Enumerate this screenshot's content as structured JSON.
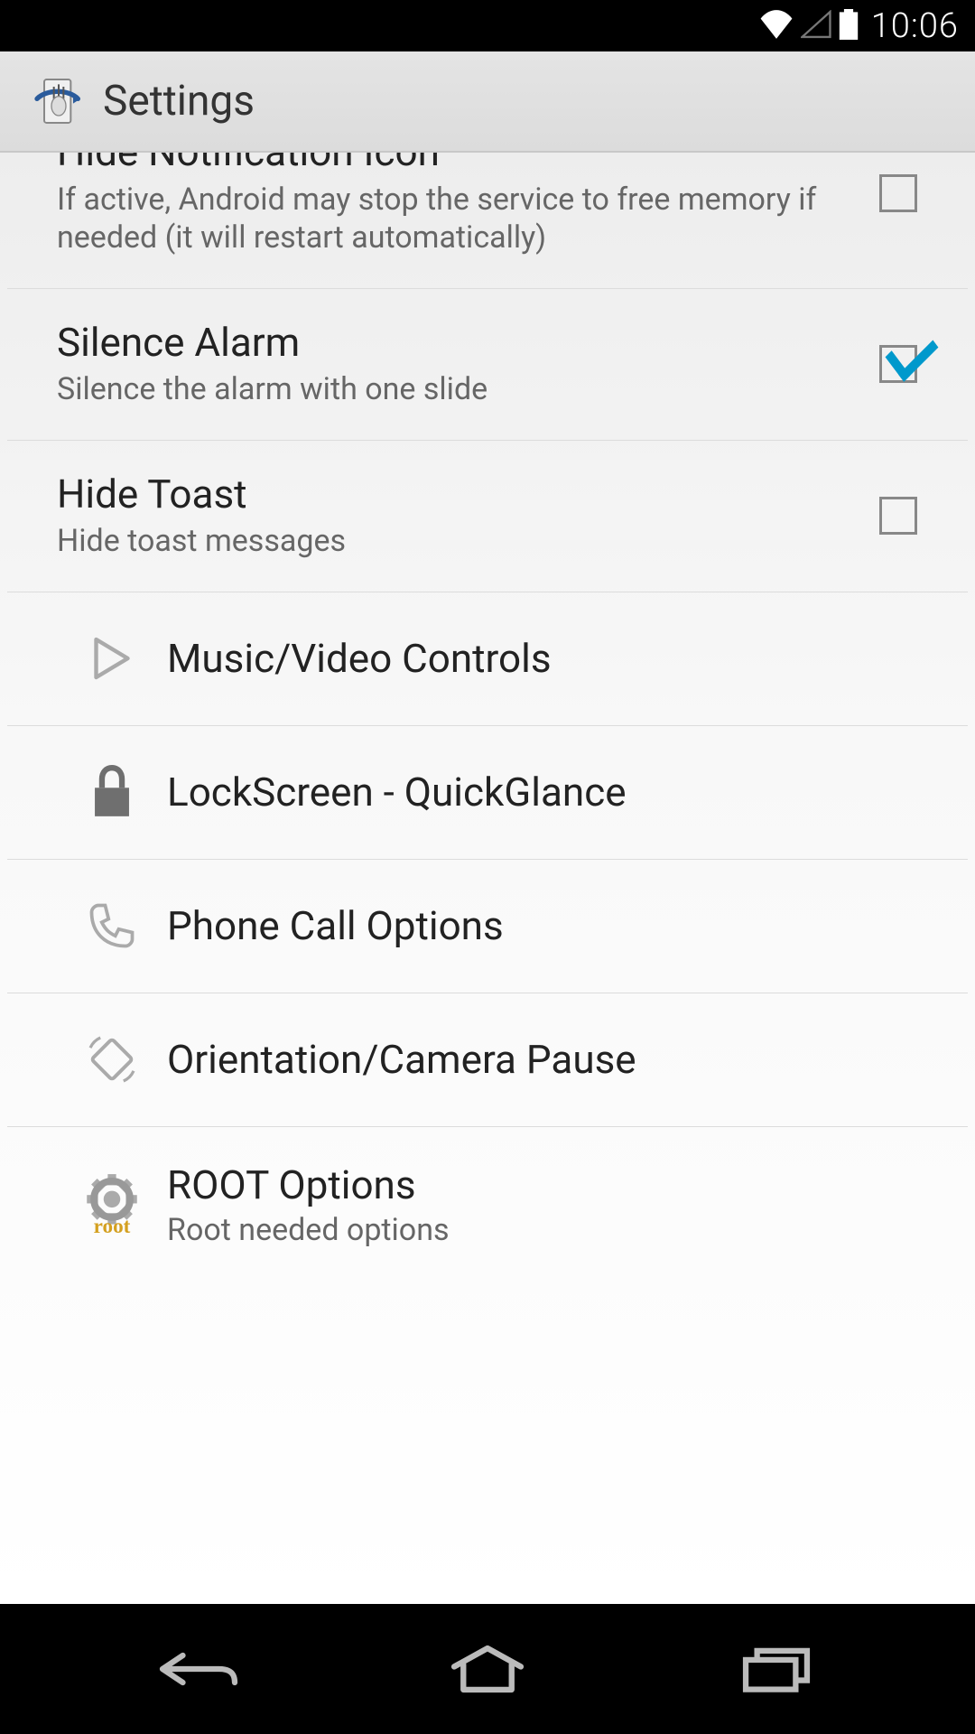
{
  "status": {
    "time": "10:06"
  },
  "header": {
    "title": "Settings"
  },
  "prefs": {
    "hide_notification": {
      "title": "Hide Notification Icon",
      "sub": "If active, Android may stop the service to free memory if needed (it will restart automatically)",
      "checked": false
    },
    "silence_alarm": {
      "title": "Silence Alarm",
      "sub": "Silence the alarm with one slide",
      "checked": true
    },
    "hide_toast": {
      "title": "Hide Toast",
      "sub": "Hide toast messages",
      "checked": false
    }
  },
  "nav_items": {
    "music": {
      "title": "Music/Video Controls"
    },
    "lockscreen": {
      "title": "LockScreen - QuickGlance"
    },
    "phone": {
      "title": "Phone Call Options"
    },
    "orientation": {
      "title": "Orientation/Camera Pause"
    },
    "root": {
      "title": "ROOT Options",
      "sub": "Root needed options"
    }
  }
}
